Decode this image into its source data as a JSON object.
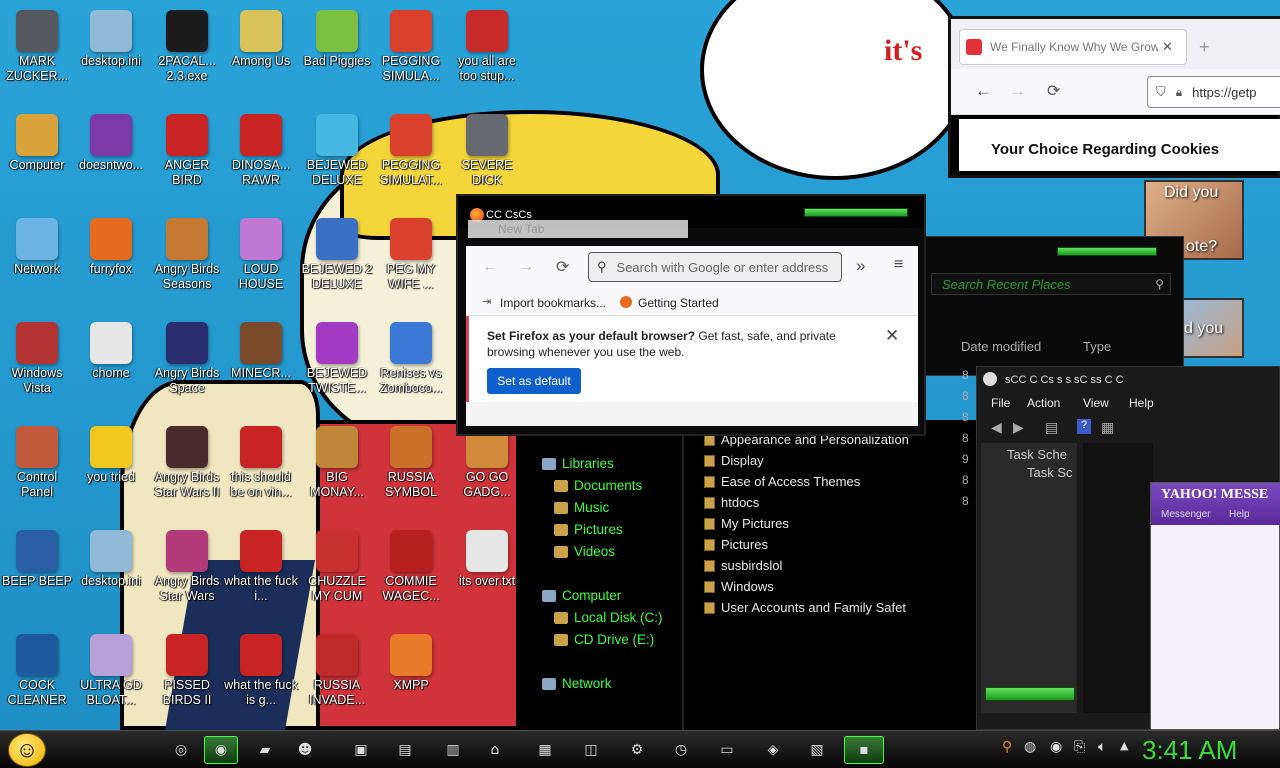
{
  "desktop_icons": [
    {
      "label": "MARK ZUCKER...",
      "icon": "mark-zuckerberg-icon",
      "color": "#55585e"
    },
    {
      "label": "desktop.ini",
      "icon": "settings-file-icon",
      "color": "#8fb9d6"
    },
    {
      "label": "2PACAL... 2.3.exe",
      "icon": "terminal-icon",
      "color": "#1c1c1c"
    },
    {
      "label": "Among Us",
      "icon": "game-icon",
      "color": "#d9c25a"
    },
    {
      "label": "Bad Piggies",
      "icon": "pig-icon",
      "color": "#7cc043"
    },
    {
      "label": "PEGGING SIMULA...",
      "icon": "p-logo-icon",
      "color": "#d9402e"
    },
    {
      "label": "you all are too stup...",
      "icon": "dev-cpp-icon",
      "color": "#c72a2a"
    },
    {
      "label": "Computer",
      "icon": "computer-icon",
      "color": "#d8a33a"
    },
    {
      "label": "doesntwo...",
      "icon": "yahoo-messenger-icon",
      "color": "#7b3aa6"
    },
    {
      "label": "ANGER BIRD",
      "icon": "angry-bird-icon",
      "color": "#c92424"
    },
    {
      "label": "DINOSA... RAWR",
      "icon": "angry-bird-icon",
      "color": "#c92424"
    },
    {
      "label": "BEJEWED DELUXE",
      "icon": "gem-icon",
      "color": "#44b8e0"
    },
    {
      "label": "PEGGING SIMULAT...",
      "icon": "p-logo-icon",
      "color": "#d9402e"
    },
    {
      "label": "SEVERE DICK",
      "icon": "gear-icon",
      "color": "#666a70"
    },
    {
      "label": "Network",
      "icon": "network-icon",
      "color": "#6ab3e4"
    },
    {
      "label": "furryfox",
      "icon": "firefox-icon",
      "color": "#e66a1e"
    },
    {
      "label": "Angry Birds Seasons",
      "icon": "angry-bird-icon",
      "color": "#c57a33"
    },
    {
      "label": "LOUD HOUSE",
      "icon": "game-icon",
      "color": "#c07ad6"
    },
    {
      "label": "BEJEWED 2 DELUXE",
      "icon": "gem-icon",
      "color": "#3a6fc4"
    },
    {
      "label": "PEG MY WIFE ...",
      "icon": "p-logo-icon",
      "color": "#d9402e"
    },
    {
      "label": "Windows Vista",
      "icon": "recycle-bin-icon",
      "color": "#b33232"
    },
    {
      "label": "chome",
      "icon": "chrome-icon",
      "color": "#e6e6e6"
    },
    {
      "label": "Angry Birds Space",
      "icon": "angry-bird-icon",
      "color": "#2a2d6e"
    },
    {
      "label": "MINECR...",
      "icon": "minecraft-icon",
      "color": "#7a4a2a"
    },
    {
      "label": "BEJEWED TWISTE...",
      "icon": "gem-icon",
      "color": "#a23ac4"
    },
    {
      "label": "Renises vs Zomboco...",
      "icon": "file-icon",
      "color": "#3a7ad6"
    },
    {
      "label": "Control Panel",
      "icon": "control-panel-icon",
      "color": "#c05a3a"
    },
    {
      "label": "you tried",
      "icon": "star-icon",
      "color": "#f0c820"
    },
    {
      "label": "Angry Birds Star Wars II",
      "icon": "angry-bird-icon",
      "color": "#4a2a2a"
    },
    {
      "label": "this should be on vin...",
      "icon": "angry-bird-icon",
      "color": "#c92424"
    },
    {
      "label": "BIG MONAY...",
      "icon": "money-bag-icon",
      "color": "#c0873a"
    },
    {
      "label": "RUSSIA SYMBOL",
      "icon": "folder-icon",
      "color": "#c9702a"
    },
    {
      "label": "GO GO GADG...",
      "icon": "gadget-icon",
      "color": "#d08a3a"
    },
    {
      "label": "BEEP BEEP",
      "icon": "file-icon",
      "color": "#2a5fa6"
    },
    {
      "label": "desktop.ini",
      "icon": "settings-file-icon",
      "color": "#8fb9d6"
    },
    {
      "label": "Angry Birds Star Wars",
      "icon": "angry-bird-icon",
      "color": "#b23a7a"
    },
    {
      "label": "what the fuck i...",
      "icon": "angry-bird-icon",
      "color": "#c92424"
    },
    {
      "label": "CHUZZLE MY CUM",
      "icon": "chuzzle-icon",
      "color": "#c93030"
    },
    {
      "label": "COMMIE WAGEC...",
      "icon": "hammer-sickle-icon",
      "color": "#b82020"
    },
    {
      "label": "its over.txt",
      "icon": "text-file-icon",
      "color": "#e6e6e6"
    },
    {
      "label": "COCK CLEANER",
      "icon": "file-icon",
      "color": "#1f5a9e"
    },
    {
      "label": "ULTRA GD BLOAT...",
      "icon": "disc-icon",
      "color": "#b8a0d8"
    },
    {
      "label": "PISSED BIRDS II",
      "icon": "angry-bird-icon",
      "color": "#c92424"
    },
    {
      "label": "what the fuck is g...",
      "icon": "angry-bird-icon",
      "color": "#c92424"
    },
    {
      "label": "RUSSIA INVADE...",
      "icon": "hammer-sickle-icon",
      "color": "#c02a2a"
    },
    {
      "label": "XMPP",
      "icon": "xampp-icon",
      "color": "#e87a2a"
    }
  ],
  "wallpaper_text": "it's",
  "popup_fragments": {
    "line1": "Did you",
    "line2": "ote?",
    "line3": "d you"
  },
  "browser_right": {
    "tab_title": "We Finally Know Why We Grow",
    "url": "https://getp",
    "cookie_heading": "Your Choice Regarding Cookies"
  },
  "firefox": {
    "title": "CC  CsCs",
    "tab_label": "New Tab",
    "search_placeholder": "Search with Google or enter address",
    "bookmarks": [
      "Import bookmarks...",
      "Getting Started"
    ],
    "notice_bold": "Set Firefox as your default browser?",
    "notice_text": " Get fast, safe, and private browsing whenever you use the web.",
    "notice_button": "Set as default"
  },
  "recent_places": {
    "search_placeholder": "Search Recent Places",
    "col_date": "Date modified",
    "col_type": "Type"
  },
  "explorer": {
    "tree": [
      {
        "label": "Libraries",
        "indent": 0
      },
      {
        "label": "Documents",
        "indent": 1
      },
      {
        "label": "Music",
        "indent": 1
      },
      {
        "label": "Pictures",
        "indent": 1
      },
      {
        "label": "Videos",
        "indent": 1
      },
      {
        "label": "Computer",
        "indent": 0
      },
      {
        "label": "Local Disk (C:)",
        "indent": 1
      },
      {
        "label": "CD Drive (E:)",
        "indent": 1
      },
      {
        "label": "Network",
        "indent": 0
      }
    ],
    "list": [
      "Appearance and Personalization",
      "Display",
      "Ease of Access Themes",
      "htdocs",
      "My Pictures",
      "Pictures",
      "susbirdslol",
      "Windows",
      "User Accounts and Family Safet"
    ],
    "side_digits": [
      "8",
      "8",
      "8",
      "8",
      "9",
      "8",
      "8"
    ]
  },
  "task_scheduler": {
    "title": "sCC  C Cs s s sC  ss C C",
    "menu": [
      "File",
      "Action",
      "View",
      "Help"
    ],
    "tree": [
      "Task Sche",
      "Task Sc"
    ]
  },
  "yahoo": {
    "logo": "YAHOO! MESSE",
    "menu": [
      "Messenger",
      "Help"
    ]
  },
  "clock": "3:41 AM",
  "colors": {
    "accent_green": "#3cff3c",
    "wallpaper_blue": "#2a9fd6",
    "clock_green": "#3cdc3c"
  }
}
